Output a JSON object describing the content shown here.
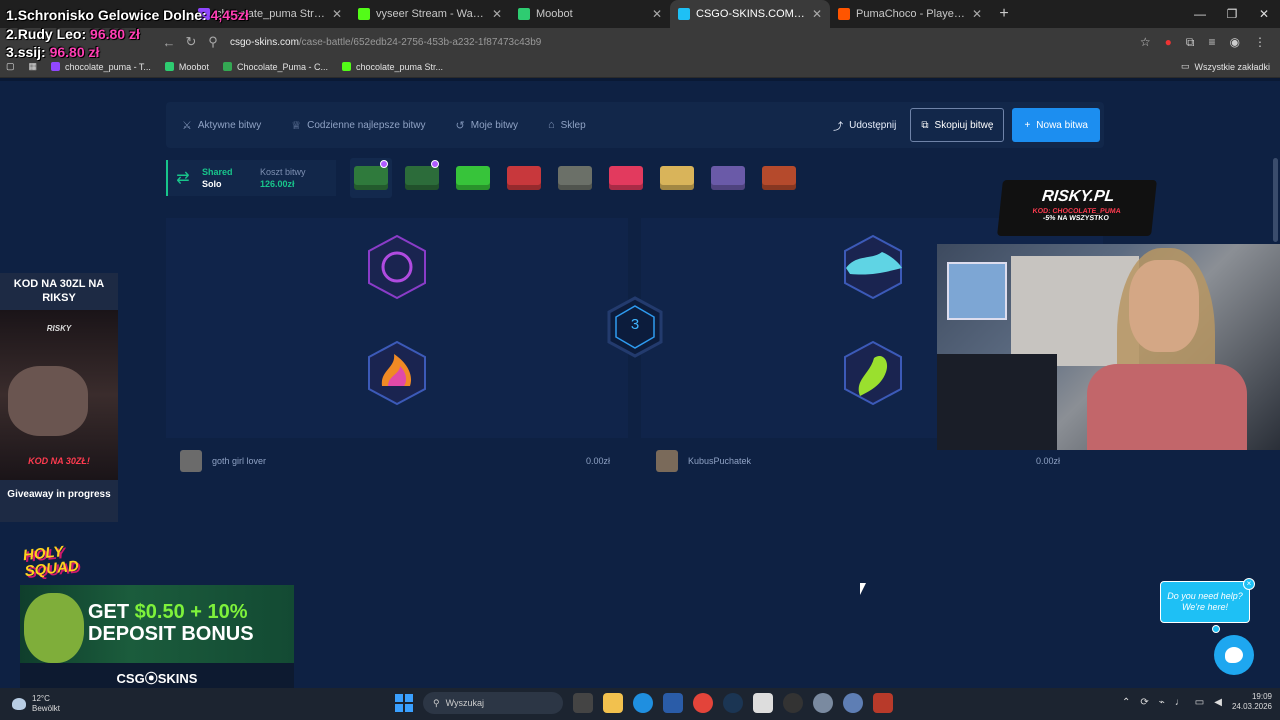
{
  "browser": {
    "tabs": [
      {
        "title": "chocolate_puma Stream - Watc",
        "favicon_color": "#9147ff",
        "active": false
      },
      {
        "title": "vyseer Stream - Watch Live on",
        "favicon_color": "#53fc18",
        "active": false
      },
      {
        "title": "Moobot",
        "favicon_color": "#2ecc71",
        "active": false
      },
      {
        "title": "CSGO-SKINS.COM - Najlepsze",
        "favicon_color": "#1ec0f5",
        "active": true
      },
      {
        "title": "PumaChoco - Player Profile - F",
        "favicon_color": "#ff5500",
        "active": false
      }
    ],
    "new_tab": "+",
    "url_host": "csgo-skins.com",
    "url_path": "/case-battle/652edb24-2756-453b-a232-1f87473c43b9",
    "bookmarks": [
      {
        "label": "chocolate_puma - T...",
        "color": "#9147ff"
      },
      {
        "label": "Moobot",
        "color": "#2ecc71"
      },
      {
        "label": "Chocolate_Puma - C...",
        "color": "#34a853"
      },
      {
        "label": "chocolate_puma Str...",
        "color": "#53fc18"
      }
    ],
    "bookmarks_other": "Wszystkie zakładki"
  },
  "leaderboard": {
    "lines": [
      {
        "prefix": "1.",
        "name": "Schronisko Gelowice Dolne:",
        "amount": "4,45zł"
      },
      {
        "prefix": "2.",
        "name": "Rudy Leo:",
        "amount": "96.80 zł"
      },
      {
        "prefix": "3.",
        "name": "ssij:",
        "amount": "96.80 zł"
      }
    ]
  },
  "nav": {
    "items": [
      {
        "icon": "crossed-swords-icon",
        "glyph": "⚔",
        "label": "Aktywne bitwy"
      },
      {
        "icon": "trophy-icon",
        "glyph": "♕",
        "label": "Codzienne najlepsze bitwy"
      },
      {
        "icon": "history-icon",
        "glyph": "↺",
        "label": "Moje bitwy"
      },
      {
        "icon": "shop-icon",
        "glyph": "⌂",
        "label": "Sklep"
      }
    ],
    "share_label": "Udostępnij",
    "copy_label": "Skopiuj bitwę",
    "new_label": "Nowa bitwa"
  },
  "battle_info": {
    "mode_label": "Shared",
    "mode_value": "Solo",
    "cost_label": "Koszt bitwy",
    "cost_value": "126.00zł"
  },
  "cases": [
    {
      "color": "#2f7a3c",
      "selected": true,
      "dot": true
    },
    {
      "color": "#2c6c3a",
      "selected": false,
      "dot": true
    },
    {
      "color": "#37c43a",
      "selected": false,
      "dot": false
    },
    {
      "color": "#c8383c",
      "selected": false,
      "dot": false
    },
    {
      "color": "#6b7068",
      "selected": false,
      "dot": false
    },
    {
      "color": "#e23a5e",
      "selected": false,
      "dot": false
    },
    {
      "color": "#d9b45a",
      "selected": false,
      "dot": false
    },
    {
      "color": "#6a5aa8",
      "selected": false,
      "dot": false
    },
    {
      "color": "#b54a2c",
      "selected": false,
      "dot": false
    }
  ],
  "round_number": "3",
  "players": [
    {
      "name": "goth girl lover",
      "amount": "0.00zł",
      "avatar_color": "#6b6b6b"
    },
    {
      "name": "KubusPuchatek",
      "amount": "0.00zł",
      "avatar_color": "#7a6a5a"
    }
  ],
  "risky_overlay": {
    "logo": "RISKY.PL",
    "code": "KOD: CHOCOLATE_PUMA",
    "discount": "-5% NA WSZYSTKO"
  },
  "kod_panel": {
    "title": "KOD NA 30ZL NA RIKSY",
    "brand": "RISKY",
    "promo": "KOD NA 30ZŁ!",
    "giveaway": "Giveaway in progress"
  },
  "holy_squad": {
    "line1": "HOLY",
    "line2": "SQUAD"
  },
  "promo_banner": {
    "line1_prefix": "GET ",
    "line1_highlight": "$0.50 + 10%",
    "line2": "DEPOSIT BONUS",
    "footer": "CSG⦿SKINS"
  },
  "help_bubble": {
    "text": "Do you need help? We're here!",
    "close": "×"
  },
  "taskbar": {
    "temperature": "12°C",
    "weather": "Bewölkt",
    "search_placeholder": "Wyszukaj",
    "time": "19:09",
    "date": "24.03.2026"
  }
}
